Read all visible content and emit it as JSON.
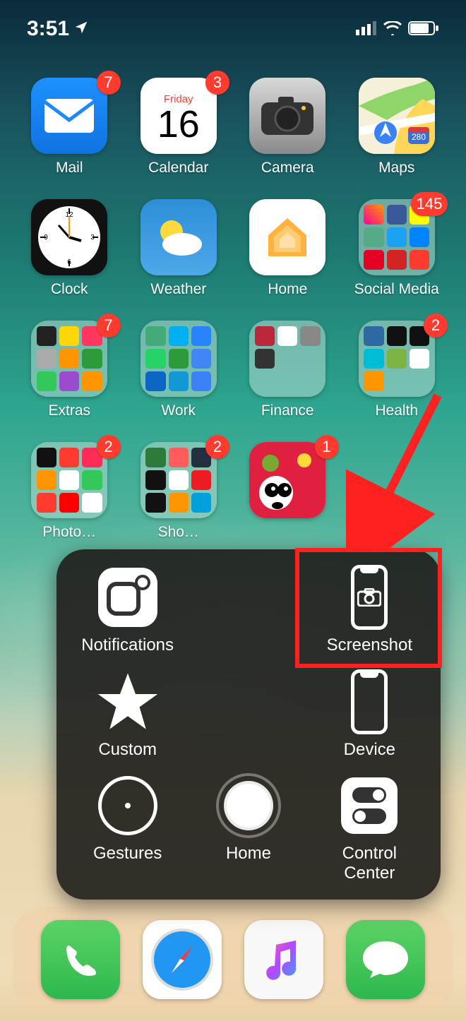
{
  "status": {
    "time": "3:51",
    "location_services": true,
    "signal_bars": 3,
    "wifi_bars": 3,
    "battery_pct": 75
  },
  "calendar": {
    "day_label": "Friday",
    "day_number": "16"
  },
  "maps_sign": "280",
  "apps": {
    "row1": [
      {
        "label": "Mail",
        "badge": "7"
      },
      {
        "label": "Calendar",
        "badge": "3"
      },
      {
        "label": "Camera"
      },
      {
        "label": "Maps"
      }
    ],
    "row2": [
      {
        "label": "Clock"
      },
      {
        "label": "Weather"
      },
      {
        "label": "Home"
      },
      {
        "label": "Social Media",
        "badge": "145"
      }
    ],
    "row3": [
      {
        "label": "Extras",
        "badge": "7"
      },
      {
        "label": "Work"
      },
      {
        "label": "Finance"
      },
      {
        "label": "Health",
        "badge": "2"
      }
    ],
    "row4": [
      {
        "label": "Photo…",
        "badge": "2"
      },
      {
        "label": "Sho…",
        "badge": "2"
      },
      {
        "label": "",
        "badge": "1"
      },
      {
        "label": ""
      }
    ]
  },
  "assistive_touch": {
    "items": {
      "notifications": "Notifications",
      "screenshot": "Screenshot",
      "custom": "Custom",
      "device": "Device",
      "gestures": "Gestures",
      "home": "Home",
      "control_center": "Control\nCenter"
    }
  },
  "annotation": {
    "highlight_target": "screenshot",
    "arrow_color": "#ff2020"
  },
  "dock": [
    {
      "label": "Phone"
    },
    {
      "label": "Safari"
    },
    {
      "label": "Music"
    },
    {
      "label": "Messages"
    }
  ]
}
